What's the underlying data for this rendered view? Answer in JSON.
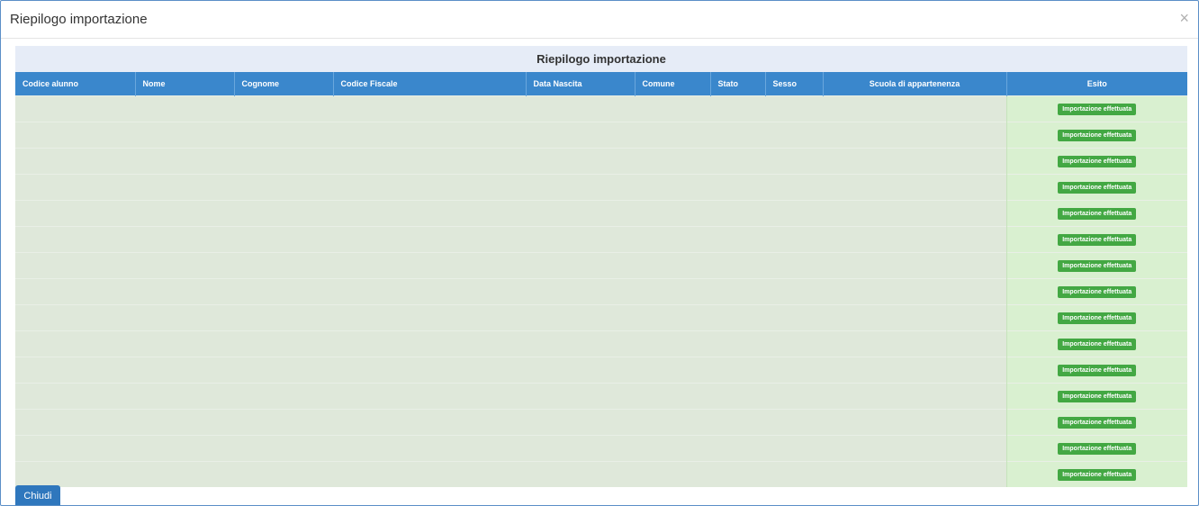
{
  "modal": {
    "title": "Riepilogo importazione",
    "close_symbol": "×",
    "close_icon": "close-icon"
  },
  "table": {
    "caption": "Riepilogo importazione",
    "columns": [
      "Codice alunno",
      "Nome",
      "Cognome",
      "Codice Fiscale",
      "Data Nascita",
      "Comune",
      "Stato",
      "Sesso",
      "Scuola di appartenenza",
      "Esito"
    ],
    "rows": [
      {
        "esito": "Importazione effettuata"
      },
      {
        "esito": "Importazione effettuata"
      },
      {
        "esito": "Importazione effettuata"
      },
      {
        "esito": "Importazione effettuata"
      },
      {
        "esito": "Importazione effettuata"
      },
      {
        "esito": "Importazione effettuata"
      },
      {
        "esito": "Importazione effettuata"
      },
      {
        "esito": "Importazione effettuata"
      },
      {
        "esito": "Importazione effettuata"
      },
      {
        "esito": "Importazione effettuata"
      },
      {
        "esito": "Importazione effettuata"
      },
      {
        "esito": "Importazione effettuata"
      },
      {
        "esito": "Importazione effettuata"
      },
      {
        "esito": "Importazione effettuata"
      },
      {
        "esito": "Importazione effettuata"
      }
    ]
  },
  "footer": {
    "close_label": "Chiudi"
  },
  "colors": {
    "header_blue": "#3a87cc",
    "caption_bg": "#e6ecf7",
    "row_bg": "#dfe8da",
    "esito_bg": "#d9f0d0",
    "badge_green": "#43a843",
    "button_blue": "#2f77bd"
  }
}
